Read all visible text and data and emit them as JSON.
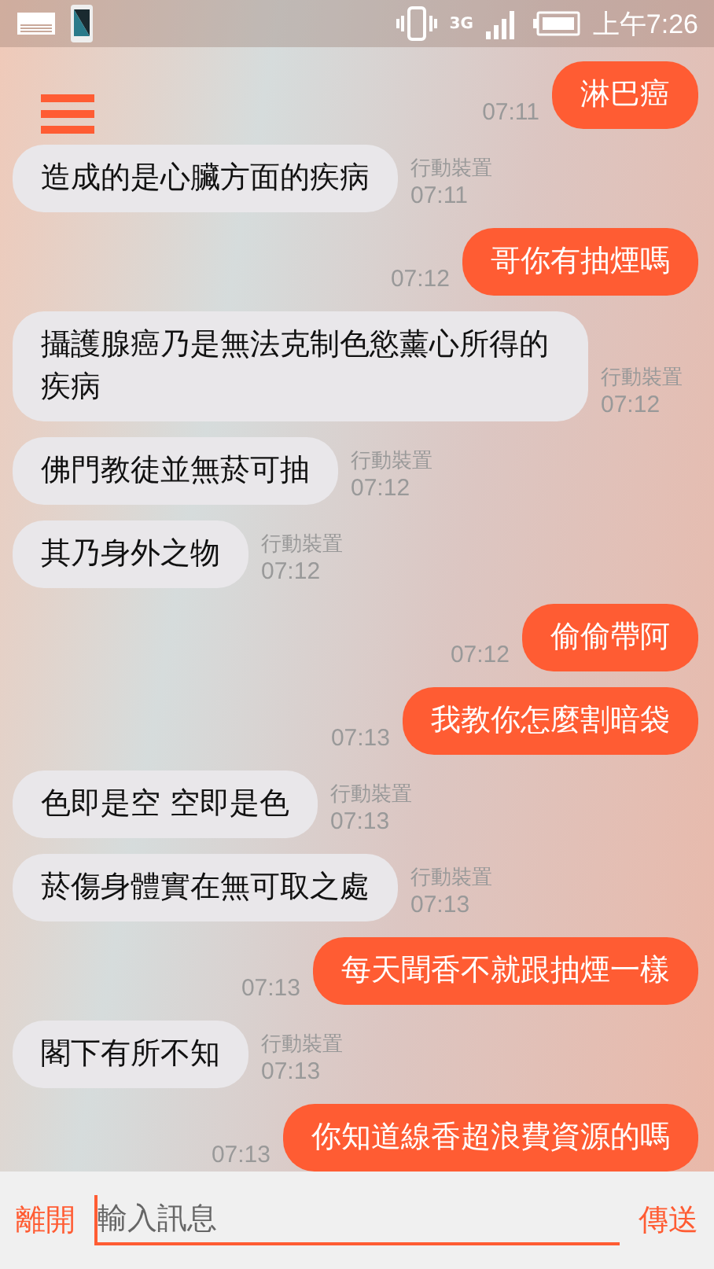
{
  "status_bar": {
    "network": "3G",
    "time": "上午7:26"
  },
  "messages": [
    {
      "kind": "sent",
      "text": "淋巴癌",
      "time": "07:11"
    },
    {
      "kind": "received",
      "text": "造成的是心臟方面的疾病",
      "sender": "行動裝置",
      "time": "07:11"
    },
    {
      "kind": "sent",
      "text": "哥你有抽煙嗎",
      "time": "07:12"
    },
    {
      "kind": "received",
      "text": "攝護腺癌乃是無法克制色慾薰心所得的疾病",
      "sender": "行動裝置",
      "time": "07:12"
    },
    {
      "kind": "received",
      "text": "佛門教徒並無菸可抽",
      "sender": "行動裝置",
      "time": "07:12"
    },
    {
      "kind": "received",
      "text": "其乃身外之物",
      "sender": "行動裝置",
      "time": "07:12"
    },
    {
      "kind": "sent",
      "text": "偷偷帶阿",
      "time": "07:12"
    },
    {
      "kind": "sent",
      "text": "我教你怎麼割暗袋",
      "time": "07:13"
    },
    {
      "kind": "received",
      "text": "色即是空 空即是色",
      "sender": "行動裝置",
      "time": "07:13"
    },
    {
      "kind": "received",
      "text": "菸傷身體實在無可取之處",
      "sender": "行動裝置",
      "time": "07:13"
    },
    {
      "kind": "sent",
      "text": "每天聞香不就跟抽煙一樣",
      "time": "07:13"
    },
    {
      "kind": "received",
      "text": "閣下有所不知",
      "sender": "行動裝置",
      "time": "07:13"
    },
    {
      "kind": "sent",
      "text": "你知道線香超浪費資源的嗎",
      "time": "07:13"
    }
  ],
  "input_bar": {
    "leave": "離開",
    "placeholder": "輸入訊息",
    "send": "傳送"
  }
}
